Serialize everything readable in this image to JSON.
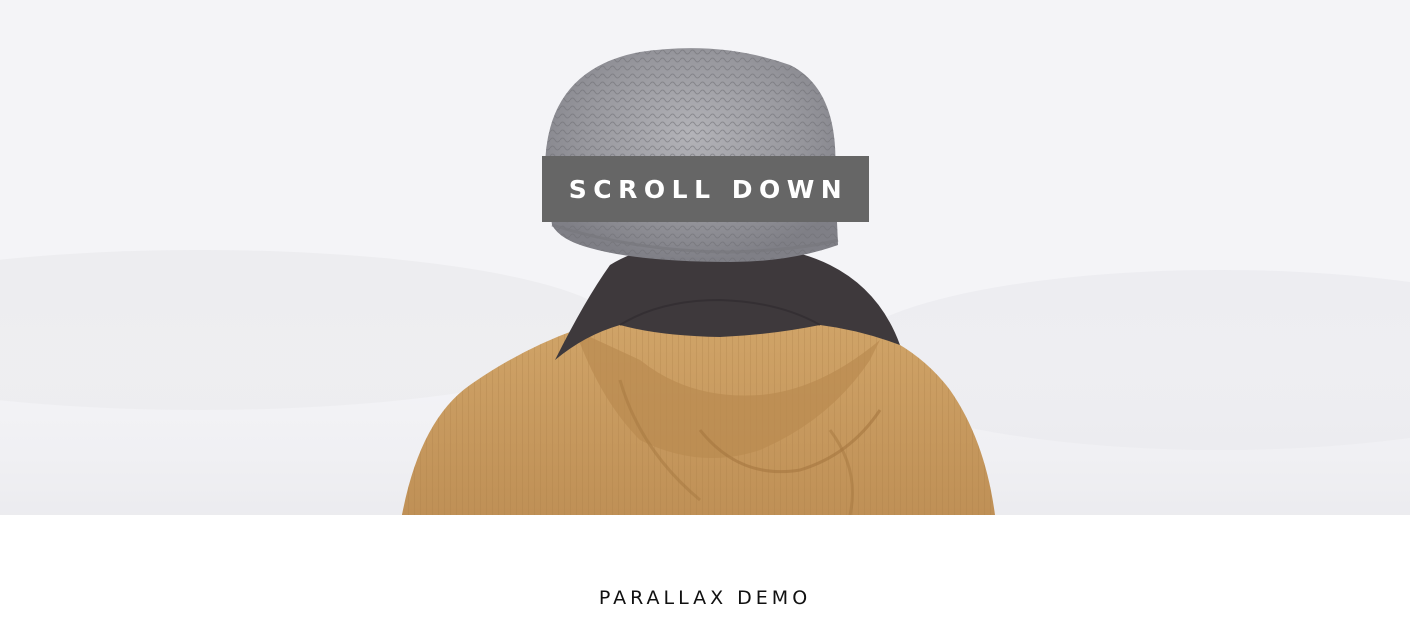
{
  "hero": {
    "image_alt": "person wearing knit beanie and tan corduroy hooded jacket, seen from behind",
    "button_label": "SCROLL DOWN"
  },
  "section": {
    "title": "PARALLAX DEMO"
  },
  "colors": {
    "button_bg": "#666666",
    "button_text": "#ffffff",
    "background": "#ffffff",
    "title_text": "#111111",
    "jacket": "#c79a5c",
    "beanie": "#9a9aa0",
    "collar": "#3f3a3d"
  }
}
